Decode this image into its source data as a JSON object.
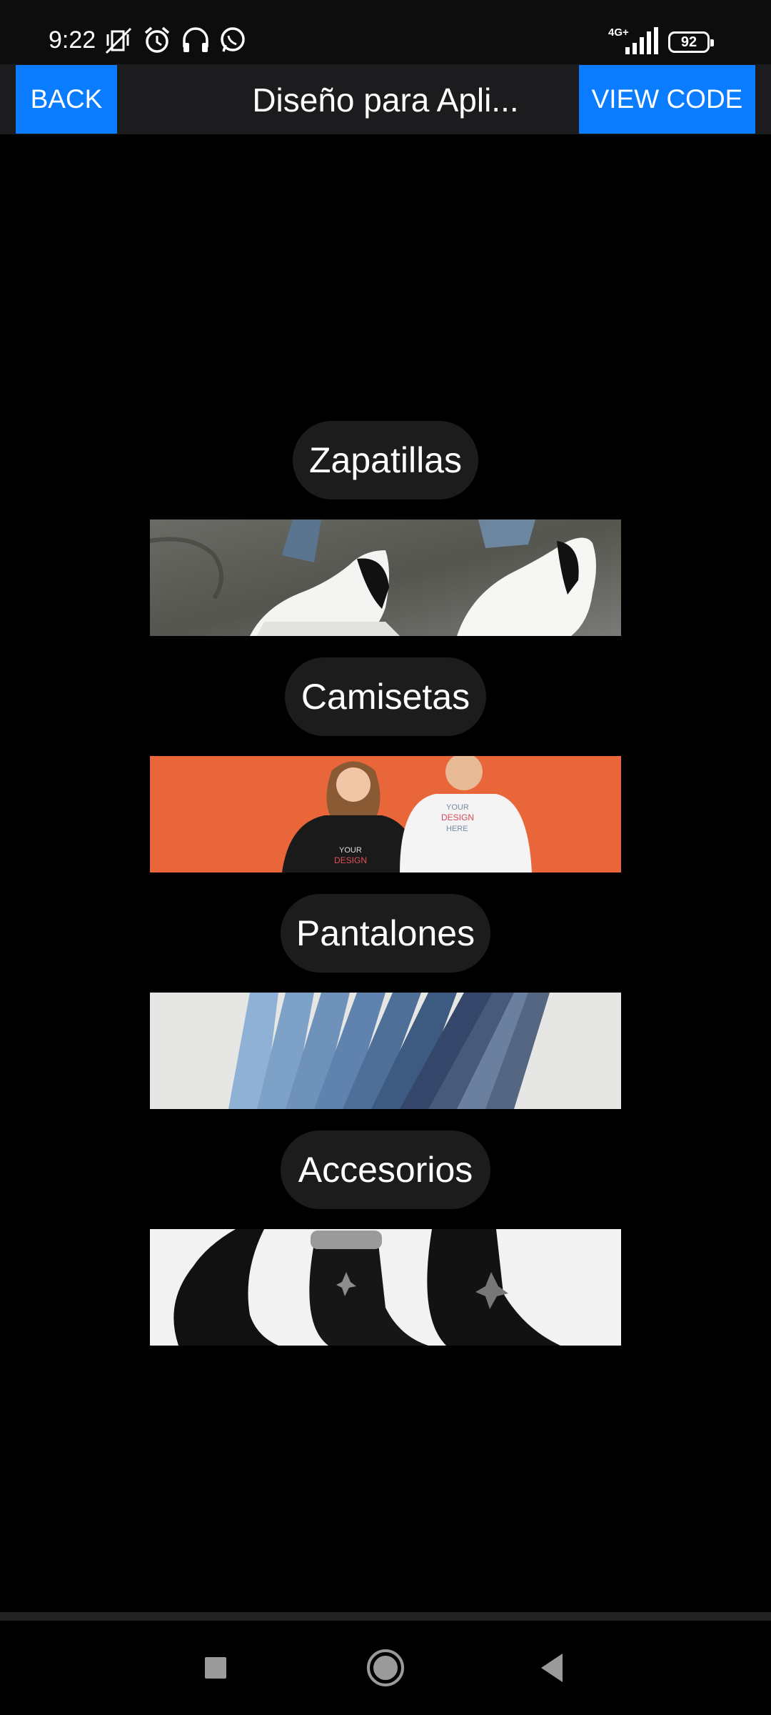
{
  "status_bar": {
    "time": "9:22",
    "network": "4G+",
    "battery": "92",
    "icons": [
      "vibrate-off-icon",
      "alarm-icon",
      "headphones-icon",
      "whatsapp-icon",
      "signal-icon",
      "battery-icon"
    ]
  },
  "header": {
    "back_label": "BACK",
    "title": "Diseño para Apli...",
    "view_code_label": "VIEW CODE"
  },
  "categories": [
    {
      "label": "Zapatillas",
      "image": "white-sneakers-photo"
    },
    {
      "label": "Camisetas",
      "image": "couple-tshirts-photo"
    },
    {
      "label": "Pantalones",
      "image": "folded-jeans-photo"
    },
    {
      "label": "Accesorios",
      "image": "black-socks-photo"
    }
  ],
  "banner_text": {
    "tshirt_line1": "YOUR",
    "tshirt_line2": "DESIGN",
    "tshirt_line3": "HERE"
  },
  "nav": {
    "icons": [
      "recents-square-icon",
      "home-circle-icon",
      "back-triangle-icon"
    ]
  },
  "colors": {
    "accent": "#0a7cff",
    "pill_bg": "#1c1c1c",
    "background": "#000000"
  }
}
